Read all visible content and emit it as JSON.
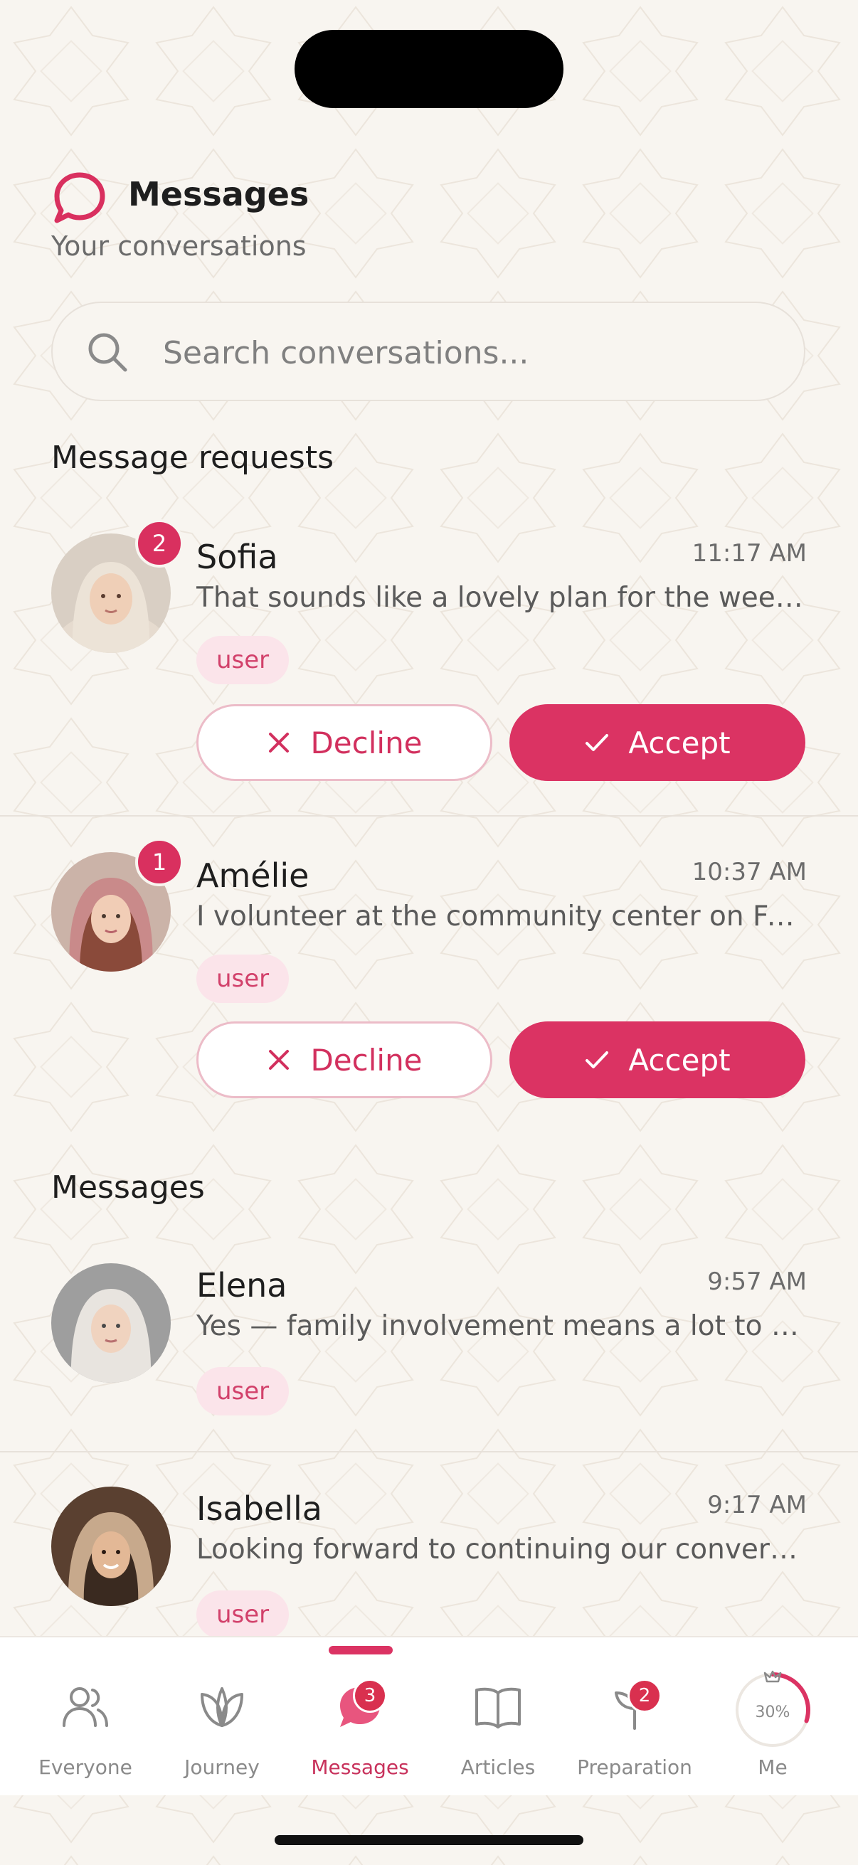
{
  "header": {
    "title": "Messages",
    "subtitle": "Your conversations",
    "icon": "chat-bubble-icon"
  },
  "search": {
    "placeholder": "Search conversations..."
  },
  "requests": {
    "title": "Message requests",
    "items": [
      {
        "name": "Sofia",
        "time": "11:17 AM",
        "preview": "That sounds like a lovely plan for the weekend!",
        "tag": "user",
        "unread": "2",
        "decline_label": "Decline",
        "accept_label": "Accept"
      },
      {
        "name": "Amélie",
        "time": "10:37 AM",
        "preview": "I volunteer at the community center on Fridays.",
        "tag": "user",
        "unread": "1",
        "decline_label": "Decline",
        "accept_label": "Accept"
      }
    ]
  },
  "messages": {
    "title": "Messages",
    "items": [
      {
        "name": "Elena",
        "time": "9:57 AM",
        "preview": "Yes — family involvement means a lot to me.",
        "tag": "user"
      },
      {
        "name": "Isabella",
        "time": "9:17 AM",
        "preview": "Looking forward to continuing our conversation.",
        "tag": "user"
      }
    ]
  },
  "nav": {
    "items": [
      {
        "label": "Everyone",
        "icon": "people-icon"
      },
      {
        "label": "Journey",
        "icon": "leaf-icon"
      },
      {
        "label": "Messages",
        "icon": "chat-bubble-icon",
        "badge": "3",
        "active": true
      },
      {
        "label": "Articles",
        "icon": "book-icon"
      },
      {
        "label": "Preparation",
        "icon": "sprout-icon",
        "badge": "2"
      },
      {
        "label": "Me",
        "icon": "profile-progress-icon",
        "progress_text": "30%",
        "progress": 0.3
      }
    ]
  },
  "colors": {
    "accent": "#db3363",
    "background": "#f8f5f0",
    "tag_bg": "#fbe4ea"
  }
}
